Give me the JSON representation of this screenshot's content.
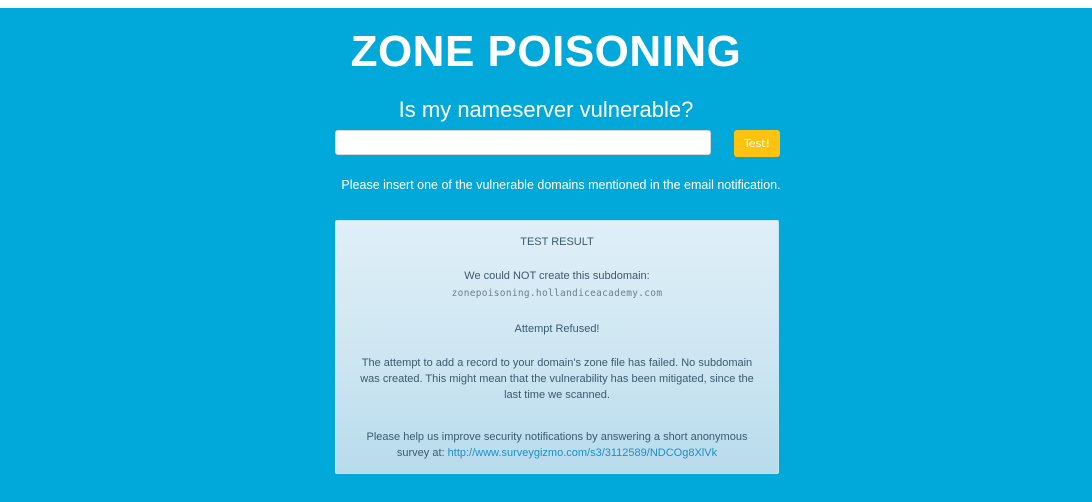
{
  "header": {
    "title": "ZONE POISONING",
    "subtitle": "Is my nameserver vulnerable?"
  },
  "form": {
    "domain_value": "",
    "test_button_label": "Test!",
    "hint": "Please insert one of the vulnerable domains mentioned in the email notification."
  },
  "result": {
    "heading": "TEST RESULT",
    "could_not_create": "We could NOT create this subdomain:",
    "subdomain": "zonepoisoning.hollandiceacademy.com",
    "status": "Attempt Refused!",
    "explanation": "The attempt to add a record to your domain's zone file has failed. No subdomain was created. This might mean that the vulnerability has been mitigated, since the last time we scanned.",
    "survey_text": "Please help us improve security notifications by answering a short anonymous survey at: ",
    "survey_link": "http://www.surveygizmo.com/s3/3112589/NDCOg8XlVk"
  },
  "colors": {
    "banner": "#00a9d9",
    "button": "#ffc20e",
    "link": "#1a8fc8"
  }
}
